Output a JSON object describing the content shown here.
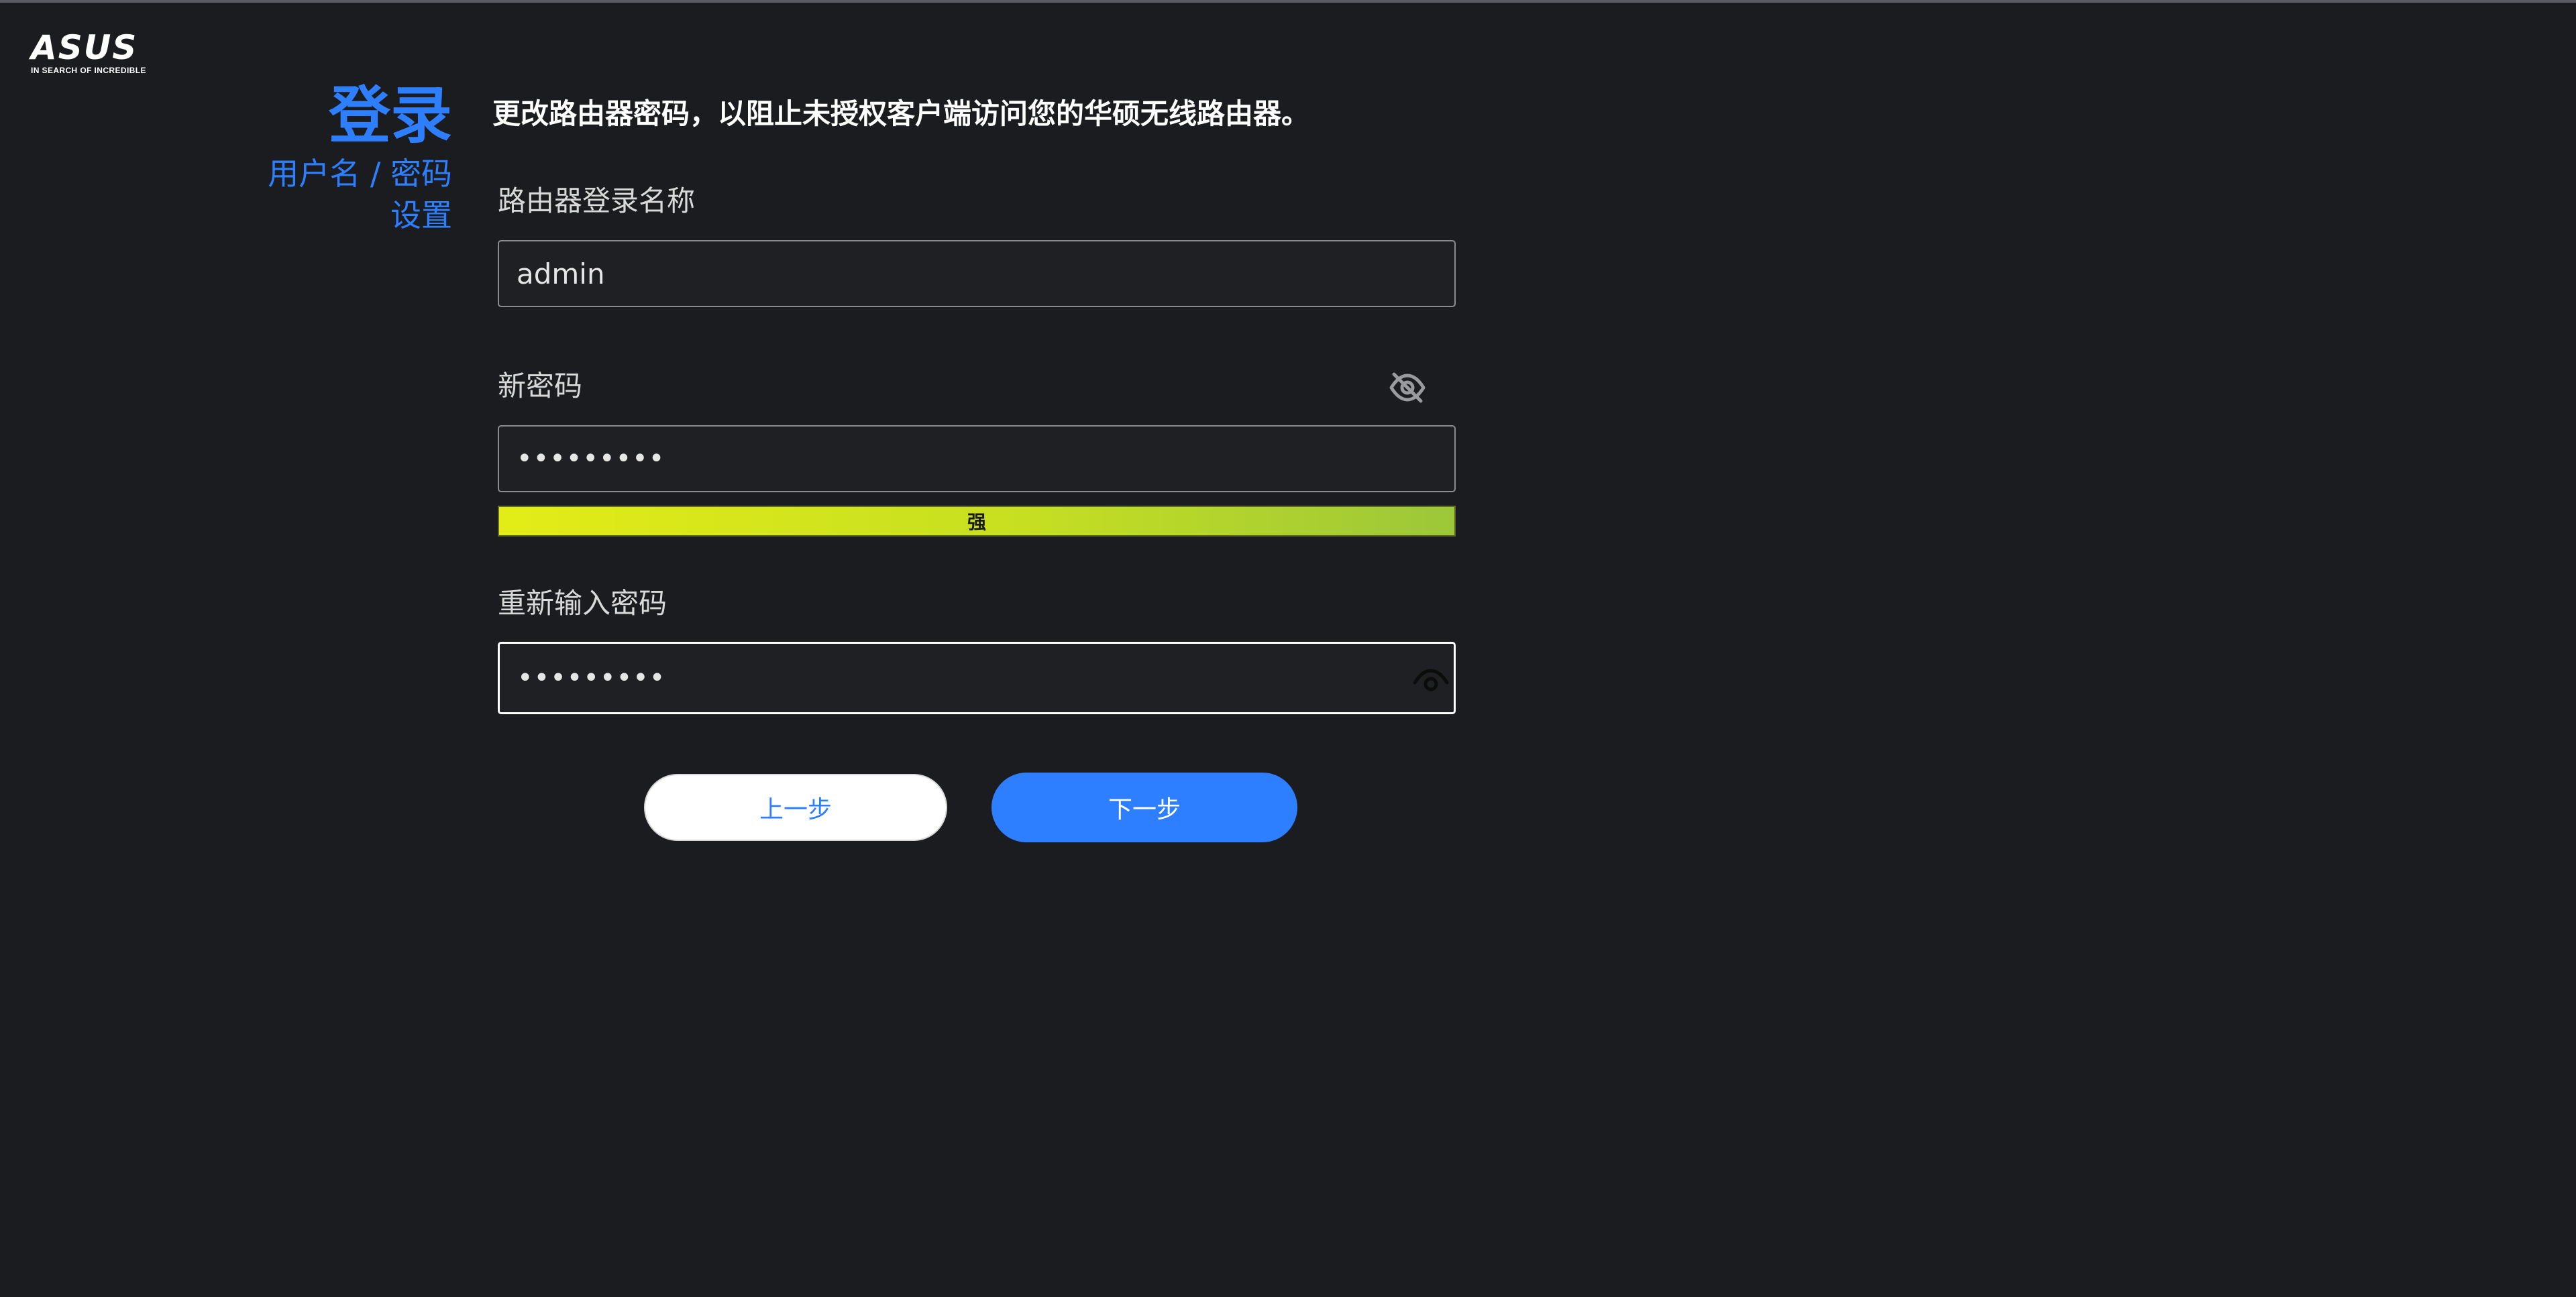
{
  "brand": {
    "logo_text": "ASUS",
    "tagline": "IN SEARCH OF INCREDIBLE"
  },
  "sidebar": {
    "title": "登录",
    "subtitle_line1": "用户名 / 密码",
    "subtitle_line2": "设置"
  },
  "main": {
    "description": "更改路由器密码，以阻止未授权客户端访问您的华硕无线路由器。",
    "username": {
      "label": "路由器登录名称",
      "value": "admin"
    },
    "new_password": {
      "label": "新密码",
      "value": "•••••••••",
      "visibility_icon": "eye-slash-icon"
    },
    "strength": {
      "label": "强",
      "level_fraction": 1.0,
      "gradient_colors": [
        "#e3ec16",
        "#9cc739"
      ]
    },
    "confirm_password": {
      "label": "重新输入密码",
      "value": "•••••••••",
      "visibility_icon": "eye-icon"
    }
  },
  "buttons": {
    "prev_label": "上一步",
    "next_label": "下一步"
  },
  "colors": {
    "accent": "#2e7fff",
    "background": "#1b1c1f"
  }
}
